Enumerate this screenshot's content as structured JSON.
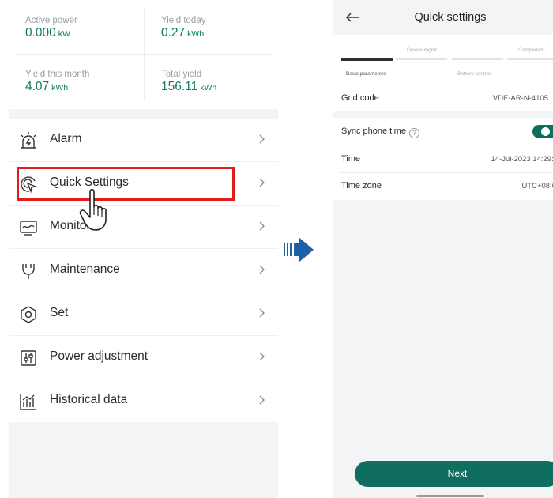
{
  "left": {
    "stats": [
      {
        "label": "Active power",
        "value": "0.000",
        "unit": "kW"
      },
      {
        "label": "Yield today",
        "value": "0.27",
        "unit": "kWh"
      },
      {
        "label": "Yield this month",
        "value": "4.07",
        "unit": "kWh"
      },
      {
        "label": "Total yield",
        "value": "156.11",
        "unit": "kWh"
      }
    ],
    "menu": [
      {
        "label": "Alarm",
        "icon": "alarm-icon"
      },
      {
        "label": "Quick Settings",
        "icon": "quick-settings-icon"
      },
      {
        "label": "Monitor",
        "icon": "monitor-icon"
      },
      {
        "label": "Maintenance",
        "icon": "maintenance-icon"
      },
      {
        "label": "Set",
        "icon": "settings-hexagon-icon"
      },
      {
        "label": "Power adjustment",
        "icon": "power-adjustment-icon"
      },
      {
        "label": "Historical data",
        "icon": "historical-data-icon"
      }
    ]
  },
  "right": {
    "title": "Quick settings",
    "steps": [
      "Basic parameters",
      "Device mgmt",
      "Battery control",
      "Completed"
    ],
    "grid_code": {
      "label": "Grid code",
      "value": "VDE-AR-N-4105"
    },
    "sync": {
      "label": "Sync phone time",
      "help": "?"
    },
    "time": {
      "label": "Time",
      "value": "14-Jul-2023 14:29:4"
    },
    "timezone": {
      "label": "Time zone",
      "value": "UTC+08:0"
    },
    "next_label": "Next"
  },
  "colors": {
    "accent": "#0f6e5f",
    "highlight": "#e21b1b",
    "arrow": "#1f5fa8"
  }
}
